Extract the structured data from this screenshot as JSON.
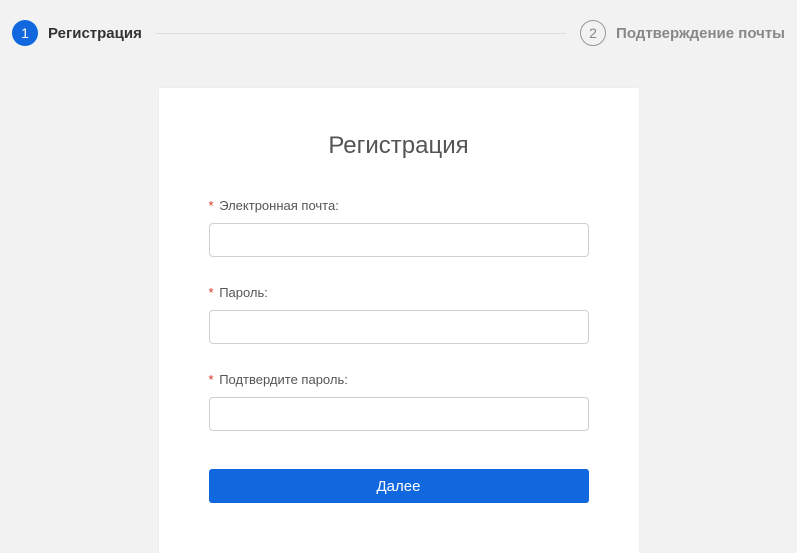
{
  "stepper": {
    "step1_num": "1",
    "step1_label": "Регистрация",
    "step2_num": "2",
    "step2_label": "Подтверждение почты"
  },
  "card": {
    "title": "Регистрация"
  },
  "form": {
    "email_label": "Электронная почта:",
    "email_value": "",
    "password_label": "Пароль:",
    "password_value": "",
    "confirm_label": "Подтвердите пароль:",
    "confirm_value": "",
    "submit_label": "Далее",
    "required_mark": "*"
  }
}
